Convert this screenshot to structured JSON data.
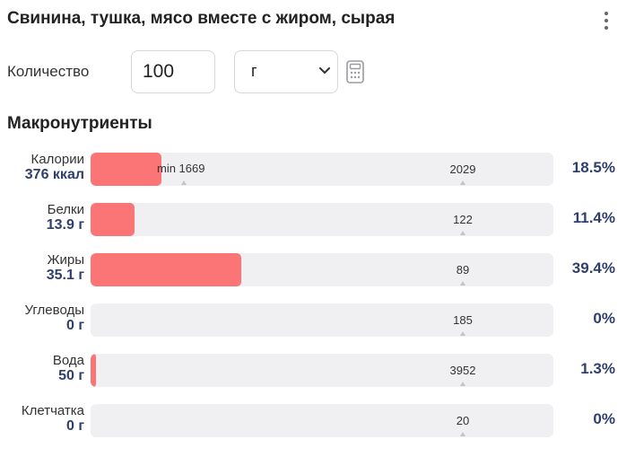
{
  "header": {
    "title": "Свинина, тушка, мясо вместе с жиром, сырая",
    "menu_icon": "kebab-vertical-icon"
  },
  "quantity": {
    "label": "Количество",
    "value": "100",
    "unit": "г",
    "unit_icon": "chevron-down-icon",
    "calculator_icon": "calculator-icon"
  },
  "macros": {
    "title": "Макронутриенты",
    "fill_color": "#fb7577",
    "items": [
      {
        "name": "Калории",
        "amount": "376 ккал",
        "min_label": "min 1669",
        "ref": "2029",
        "percent": "18.5%",
        "fraction": 0.185
      },
      {
        "name": "Белки",
        "amount": "13.9 г",
        "min_label": "",
        "ref": "122",
        "percent": "11.4%",
        "fraction": 0.114
      },
      {
        "name": "Жиры",
        "amount": "35.1 г",
        "min_label": "",
        "ref": "89",
        "percent": "39.4%",
        "fraction": 0.394
      },
      {
        "name": "Углеводы",
        "amount": "0 г",
        "min_label": "",
        "ref": "185",
        "percent": "0%",
        "fraction": 0
      },
      {
        "name": "Вода",
        "amount": "50 г",
        "min_label": "",
        "ref": "3952",
        "percent": "1.3%",
        "fraction": 0.013
      },
      {
        "name": "Клетчатка",
        "amount": "0 г",
        "min_label": "",
        "ref": "20",
        "percent": "0%",
        "fraction": 0
      }
    ]
  }
}
